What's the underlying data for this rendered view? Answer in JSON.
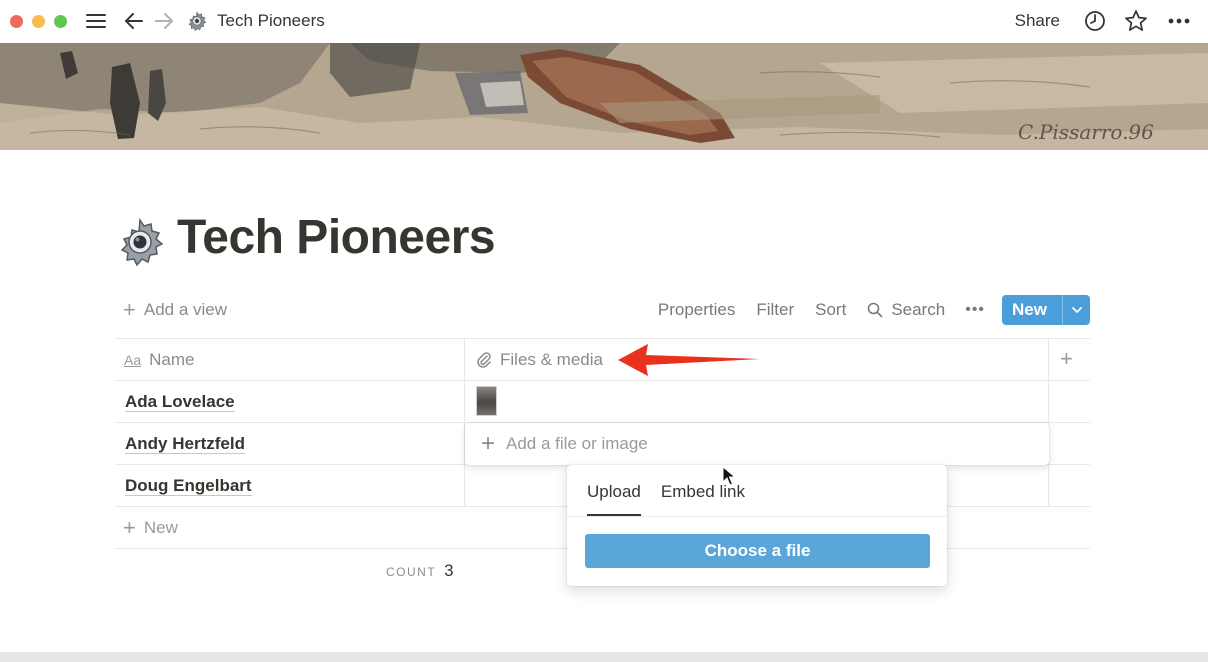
{
  "topbar": {
    "page_title": "Tech Pioneers",
    "share_label": "Share"
  },
  "page": {
    "title": "Tech Pioneers",
    "icon": "gear-icon"
  },
  "cover": {
    "signature": "C.Pissarro.96"
  },
  "view_bar": {
    "add_view_label": "Add a view",
    "properties_label": "Properties",
    "filter_label": "Filter",
    "sort_label": "Sort",
    "search_label": "Search",
    "more_label": "•••",
    "new_label": "New"
  },
  "table": {
    "columns": [
      {
        "label": "Name",
        "type_icon": "Aa"
      },
      {
        "label": "Files & media",
        "type_icon": "paperclip-icon"
      }
    ],
    "rows": [
      {
        "name": "Ada Lovelace",
        "has_thumbnail": true
      },
      {
        "name": "Andy Hertzfeld",
        "has_thumbnail": false
      },
      {
        "name": "Doug Engelbart",
        "has_thumbnail": false
      }
    ],
    "new_row_label": "New",
    "count_label": "COUNT",
    "count_value": "3"
  },
  "file_popup": {
    "add_label": "Add a file or image",
    "tabs": [
      "Upload",
      "Embed link"
    ],
    "active_tab": "Upload",
    "choose_label": "Choose a file"
  },
  "colors": {
    "accent": "#4a9fdb",
    "annotation_arrow": "#e8321e"
  }
}
